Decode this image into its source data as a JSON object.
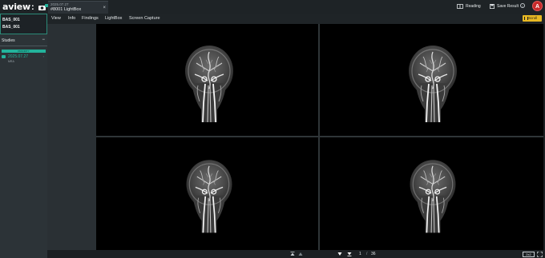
{
  "app": {
    "logo": "aview",
    "logo_colon": ":"
  },
  "tab": {
    "date": "2025.07.27",
    "title": "#8001 LightBox",
    "close": "×"
  },
  "toolbar": {
    "reading_label": "Reading",
    "save_label": "Save Result",
    "info_symbol": "i",
    "avatar_letter": "A"
  },
  "patient": {
    "id": "BAS_001",
    "name": "BAS_001"
  },
  "studies": {
    "label": "Studies",
    "collapse_symbol": "−",
    "priority_label": "PRIORITY",
    "items": [
      {
        "date": "2025.07.27",
        "modality": "MRA",
        "arrow": "›"
      }
    ]
  },
  "menu": {
    "items": [
      "View",
      "Info",
      "Findings",
      "LightBox",
      "Screen Capture"
    ]
  },
  "scroll_button": {
    "label": "Scroll"
  },
  "pager": {
    "current": "1",
    "separator": "/",
    "total": "36"
  },
  "layout_button": {
    "label": "2x2"
  },
  "colors": {
    "accent": "#23b39b",
    "avatar": "#c62a2a",
    "scroll": "#e8b923"
  }
}
